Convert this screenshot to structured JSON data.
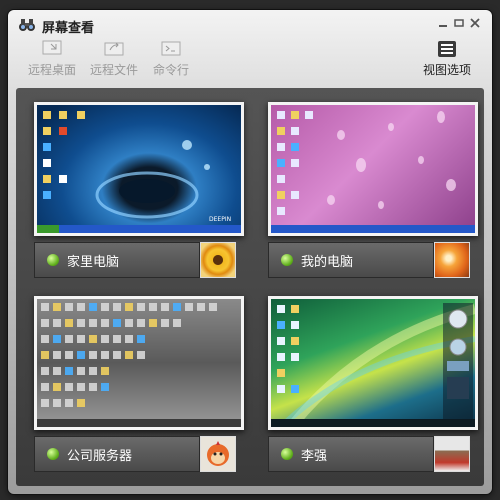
{
  "window": {
    "title": "屏幕查看"
  },
  "toolbar": {
    "remote_desktop": "远程桌面",
    "remote_files": "远程文件",
    "command_line": "命令行",
    "view_options": "视图选项"
  },
  "computers": [
    {
      "name": "家里电脑",
      "status": "online",
      "wallpaper": "water-drop-blue",
      "avatar": "sunflower",
      "desktop_badge": "DEEPIN"
    },
    {
      "name": "我的电脑",
      "status": "online",
      "wallpaper": "purple-water-drops",
      "avatar": "orange-flower"
    },
    {
      "name": "公司服务器",
      "status": "online",
      "wallpaper": "grey-cluttered",
      "avatar": "cartoon-monkey"
    },
    {
      "name": "李强",
      "status": "online",
      "wallpaper": "vista-aurora",
      "avatar": "landscape"
    }
  ],
  "colors": {
    "online": "#5fae1b"
  }
}
